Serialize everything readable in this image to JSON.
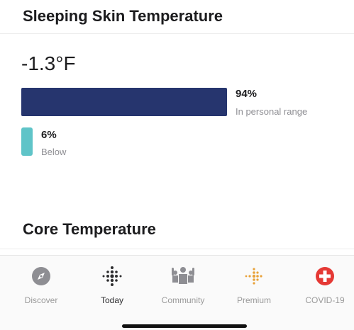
{
  "section1": {
    "title": "Sleeping Skin Temperature",
    "value": "-1.3°F",
    "in_range_percent": "94%",
    "in_range_label": "In personal range",
    "in_range_fraction": 0.94,
    "below_percent": "6%",
    "below_label": "Below",
    "below_fraction": 0.06
  },
  "section2": {
    "title": "Core Temperature"
  },
  "colors": {
    "in_range": "#26356e",
    "below": "#5fc4c8",
    "premium": "#e8a23a",
    "covid": "#e53935"
  },
  "tabbar": {
    "tabs": [
      {
        "label": "Discover",
        "icon": "compass-icon"
      },
      {
        "label": "Today",
        "icon": "fitbit-dots-icon",
        "active": true
      },
      {
        "label": "Community",
        "icon": "community-icon"
      },
      {
        "label": "Premium",
        "icon": "premium-dots-icon"
      },
      {
        "label": "COVID-19",
        "icon": "medical-cross-icon"
      }
    ]
  }
}
